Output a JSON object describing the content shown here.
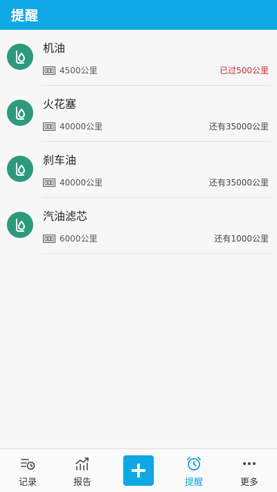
{
  "header": {
    "title": "提醒"
  },
  "reminders": [
    {
      "name": "机油",
      "mileage": "4500公里",
      "status": "已过500公里"
    },
    {
      "name": "火花塞",
      "mileage": "40000公里",
      "status": "还有35000公里"
    },
    {
      "name": "刹车油",
      "mileage": "40000公里",
      "status": "还有35000公里"
    },
    {
      "name": "汽油滤芯",
      "mileage": "6000公里",
      "status": "还有1000公里"
    }
  ],
  "tabbar": {
    "items": [
      {
        "label": "记录",
        "icon": "record-icon"
      },
      {
        "label": "报告",
        "icon": "report-chart-icon"
      },
      {
        "label": "",
        "icon": "plus-icon"
      },
      {
        "label": "提醒",
        "icon": "alarm-clock-icon"
      },
      {
        "label": "更多",
        "icon": "more-dots-icon"
      }
    ]
  },
  "colors": {
    "header": "#10a7e6",
    "icon_circle": "#2e9a7d",
    "overdue": "#d0282e",
    "active_tab": "#13a0dd"
  }
}
